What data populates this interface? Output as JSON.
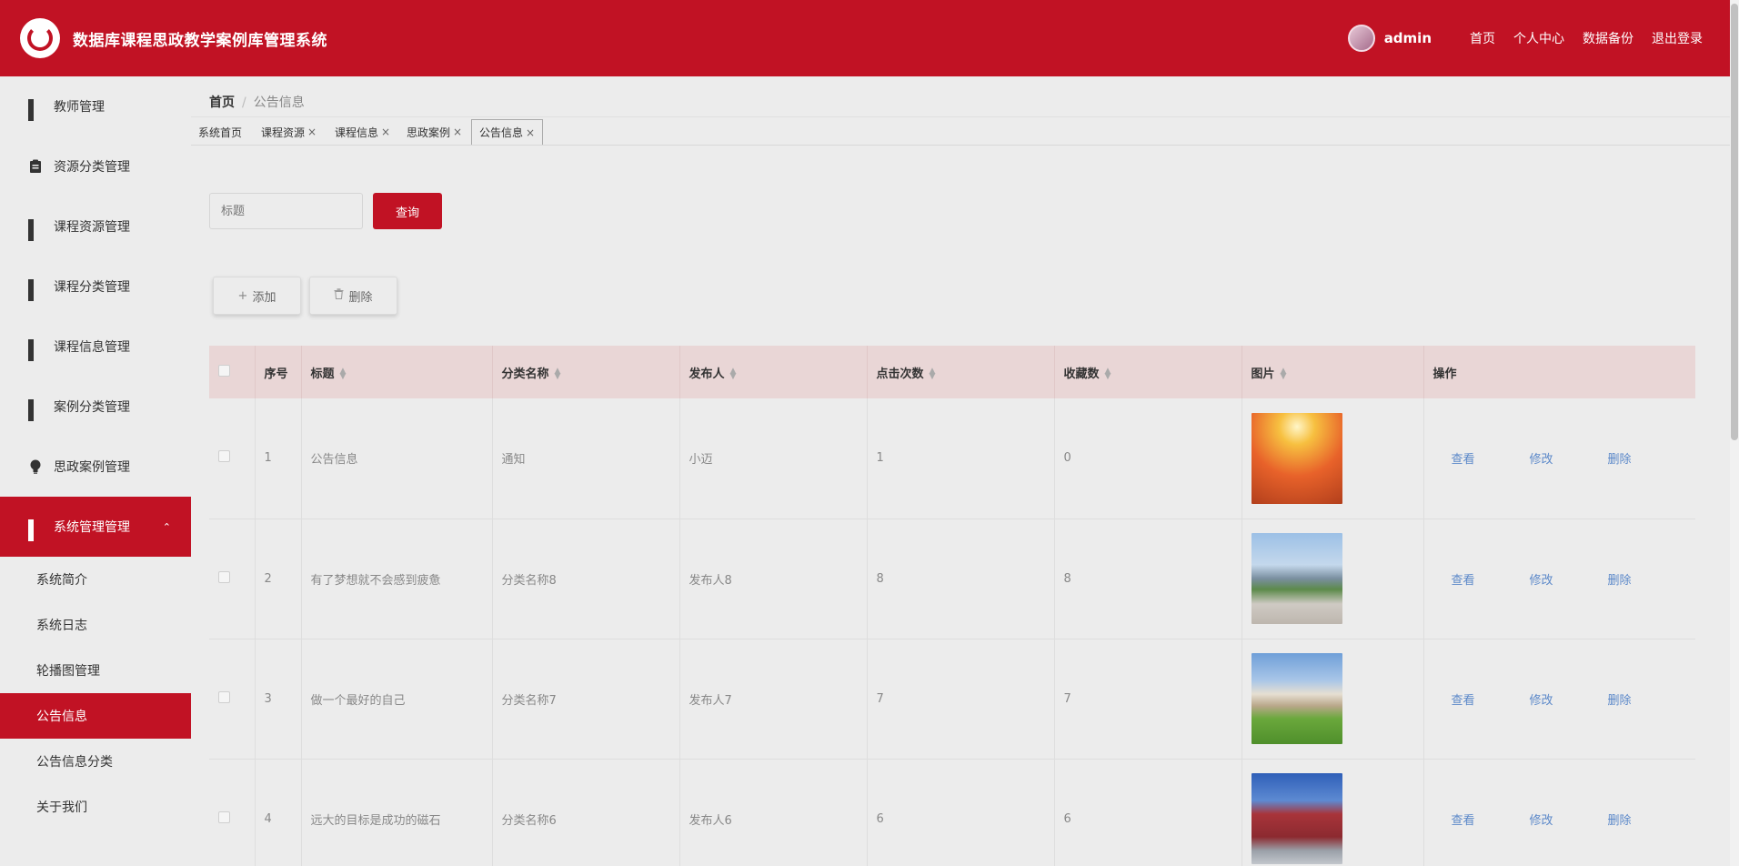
{
  "app": {
    "title": "数据库课程思政教学案例库管理系统"
  },
  "header": {
    "username": "admin",
    "links": [
      "首页",
      "个人中心",
      "数据备份",
      "退出登录"
    ]
  },
  "sidebar": {
    "items": [
      {
        "label": "教师管理",
        "icon": "grid-icon"
      },
      {
        "label": "资源分类管理",
        "icon": "clipboard-icon"
      },
      {
        "label": "课程资源管理",
        "icon": "grid-icon"
      },
      {
        "label": "课程分类管理",
        "icon": "grid-icon"
      },
      {
        "label": "课程信息管理",
        "icon": "grid-icon"
      },
      {
        "label": "案例分类管理",
        "icon": "grid-icon"
      },
      {
        "label": "思政案例管理",
        "icon": "bulb-icon"
      },
      {
        "label": "系统管理管理",
        "icon": "grid-icon"
      }
    ],
    "subitems": [
      "系统简介",
      "系统日志",
      "轮播图管理",
      "公告信息",
      "公告信息分类",
      "关于我们"
    ]
  },
  "breadcrumb": {
    "home": "首页",
    "current": "公告信息"
  },
  "tabs": [
    {
      "label": "系统首页"
    },
    {
      "label": "课程资源"
    },
    {
      "label": "课程信息"
    },
    {
      "label": "思政案例"
    },
    {
      "label": "公告信息"
    }
  ],
  "search": {
    "placeholder": "标题",
    "button": "查询"
  },
  "actions": {
    "add": "添加",
    "delete": "删除"
  },
  "table": {
    "headers": [
      "序号",
      "标题",
      "分类名称",
      "发布人",
      "点击次数",
      "收藏数",
      "图片",
      "操作"
    ],
    "ops": [
      "查看",
      "修改",
      "删除"
    ],
    "rows": [
      {
        "no": "1",
        "title": "公告信息",
        "category": "通知",
        "publisher": "小迈",
        "clicks": "1",
        "favs": "0"
      },
      {
        "no": "2",
        "title": "有了梦想就不会感到疲惫",
        "category": "分类名称8",
        "publisher": "发布人8",
        "clicks": "8",
        "favs": "8"
      },
      {
        "no": "3",
        "title": "做一个最好的自己",
        "category": "分类名称7",
        "publisher": "发布人7",
        "clicks": "7",
        "favs": "7"
      },
      {
        "no": "4",
        "title": "远大的目标是成功的磁石",
        "category": "分类名称6",
        "publisher": "发布人6",
        "clicks": "6",
        "favs": "6"
      }
    ]
  },
  "colors": {
    "primary": "#c11224",
    "header_bg": "#e9d6d6",
    "link": "#5b88c9"
  }
}
